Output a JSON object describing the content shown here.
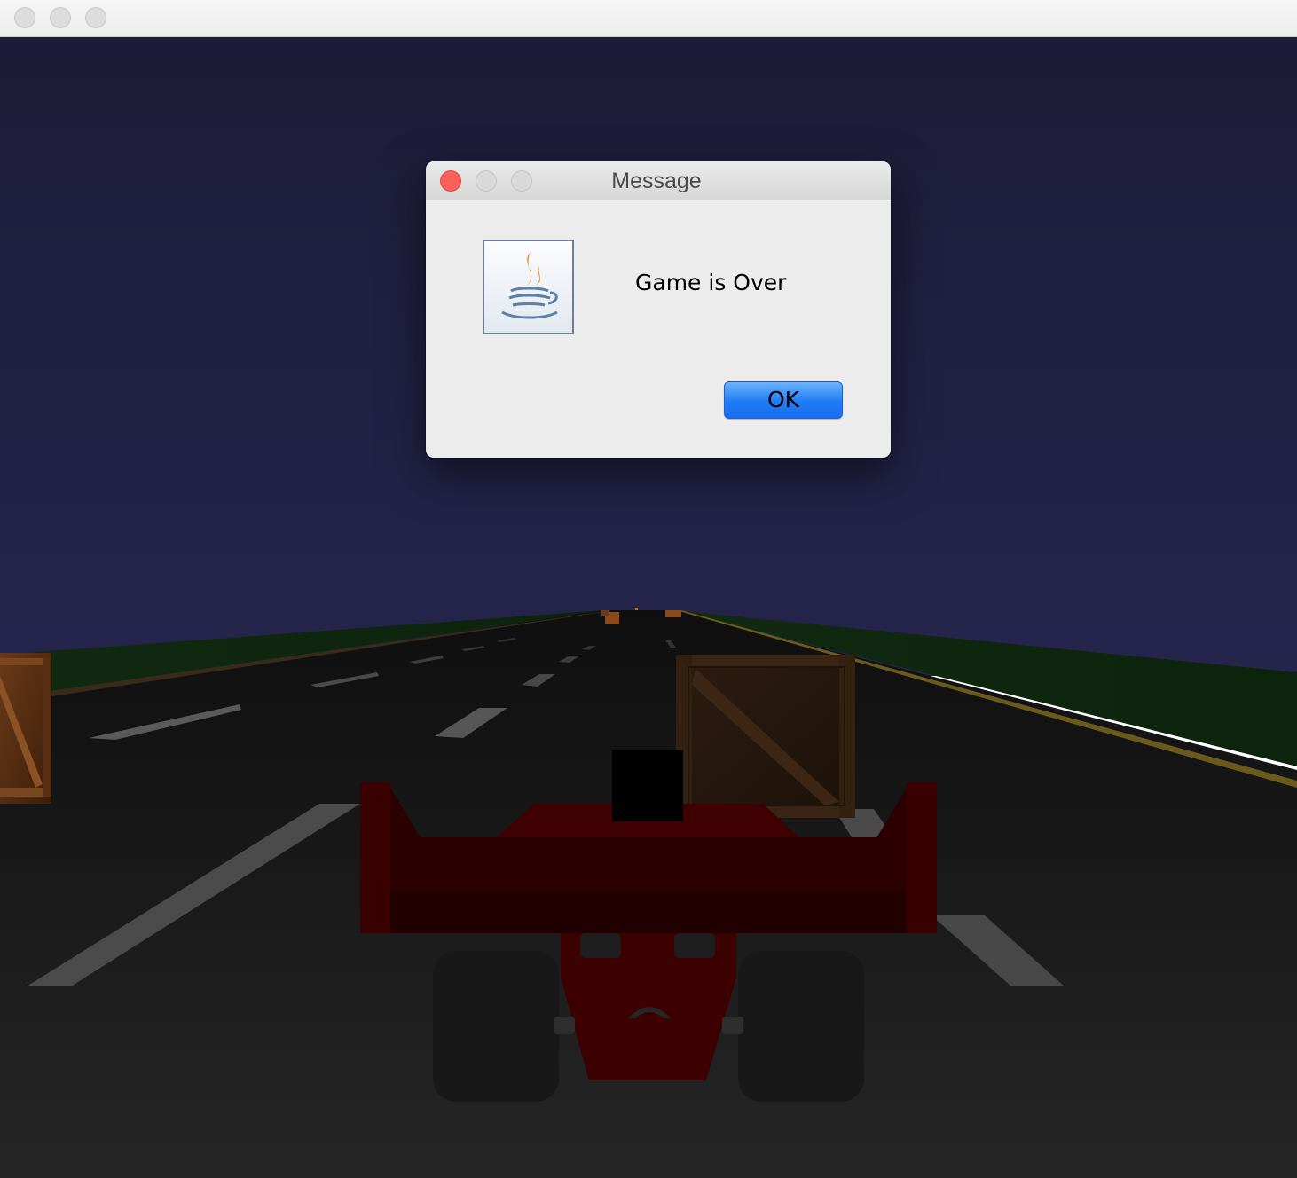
{
  "window": {
    "title": ""
  },
  "game": {
    "sky_color": "#1b1c36",
    "road_color": "#141414",
    "grass_color": "#0e2a0e",
    "car_color": "#3d0000"
  },
  "dialog": {
    "title": "Message",
    "icon": "java-coffee-cup-icon",
    "message": "Game is Over",
    "ok_label": "OK"
  }
}
